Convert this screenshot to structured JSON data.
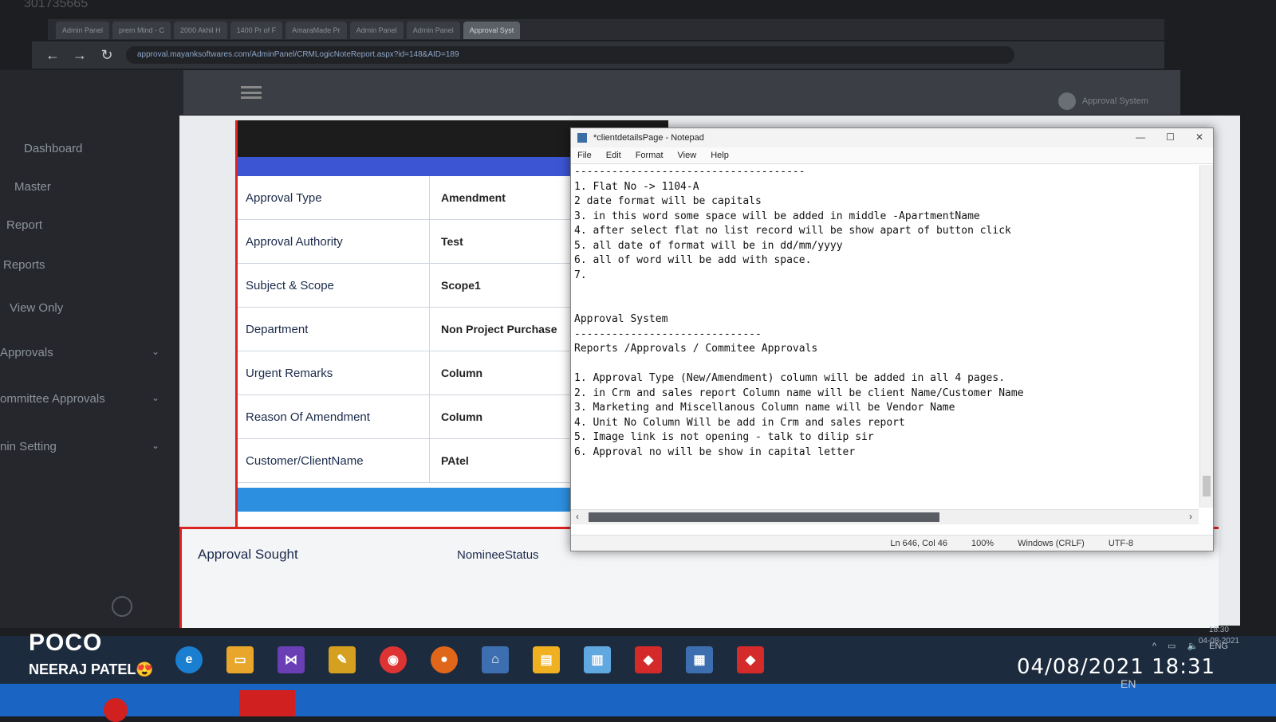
{
  "photo_header_number": "301735665",
  "browser": {
    "tabs": [
      "Admin Panel",
      "prem Mind - C",
      "2000 Akhil H",
      "1400 Pr of F",
      "AmaraMade Pr",
      "Admin Panel",
      "Admin Panel",
      "Approval Syst"
    ],
    "url": "approval.mayanksoftwares.com/AdminPanel/CRMLogicNoteReport.aspx?id=148&AID=189"
  },
  "sidebar": {
    "items": [
      {
        "label": "Dashboard"
      },
      {
        "label": "Master"
      },
      {
        "label": "Report"
      },
      {
        "label": "Reports"
      },
      {
        "label": "View Only"
      },
      {
        "label": "Approvals",
        "chev": "⌄"
      },
      {
        "label": "ommittee Approvals",
        "chev": "⌄"
      },
      {
        "label": "nin Setting",
        "chev": "⌄"
      }
    ]
  },
  "header": {
    "user": "Approval System"
  },
  "details": {
    "rows": [
      {
        "label": "Approval Type",
        "value": "Amendment"
      },
      {
        "label": "Approval Authority",
        "value": "Test"
      },
      {
        "label": "Subject & Scope",
        "value": "Scope1"
      },
      {
        "label": "Department",
        "value": "Non Project Purchase"
      },
      {
        "label": "Urgent Remarks",
        "value": "Column"
      },
      {
        "label": "Reason Of Amendment",
        "value": "Column"
      },
      {
        "label": "Customer/ClientName",
        "value": "PAtel"
      }
    ],
    "approval_sought_label": "Approval Sought",
    "approval_sought_value": "NomineeStatus"
  },
  "notepad": {
    "title": "*clientdetailsPage - Notepad",
    "menu": [
      "File",
      "Edit",
      "Format",
      "View",
      "Help"
    ],
    "text": "-------------------------------------\n1. Flat No -> 1104-A\n2 date format will be capitals\n3. in this word some space will be added in middle -ApartmentName\n4. after select flat no list record will be show apart of button click\n5. all date of format will be in dd/mm/yyyy\n6. all of word will be add with space.\n7.\n\n\nApproval System\n------------------------------\nReports /Approvals / Commitee Approvals\n\n1. Approval Type (New/Amendment) column will be added in all 4 pages.\n2. in Crm and sales report Column name will be client Name/Customer Name\n3. Marketing and Miscellanous Column name will be Vendor Name\n4. Unit No Column Will be add in Crm and sales report\n5. Image link is not opening - talk to dilip sir\n6. Approval no will be show in capital letter",
    "status": {
      "position": "Ln 646, Col 46",
      "zoom": "100%",
      "eol": "Windows (CRLF)",
      "encoding": "UTF-8"
    }
  },
  "taskbar": {
    "apps": [
      "edge-icon",
      "file-explorer-icon",
      "visual-studio-icon",
      "paint-icon",
      "chrome-icon",
      "firefox-icon",
      "network-icon",
      "sticky-notes-icon",
      "notepad-icon",
      "anydesk-icon",
      "calculator-icon",
      "anydesk2-icon"
    ],
    "tray_lang": "ENG",
    "tray_time": "18:30",
    "tray_date": "04-08-2021",
    "keyboard": "EN"
  },
  "watermark": {
    "brand": "POCO",
    "author": "NEERAJ PATEL😍",
    "datetime": "04/08/2021 18:31"
  },
  "colors": {
    "accent_blue": "#3c55d2",
    "bar_blue": "#2d8fe0",
    "accent_red": "#dd2222"
  }
}
